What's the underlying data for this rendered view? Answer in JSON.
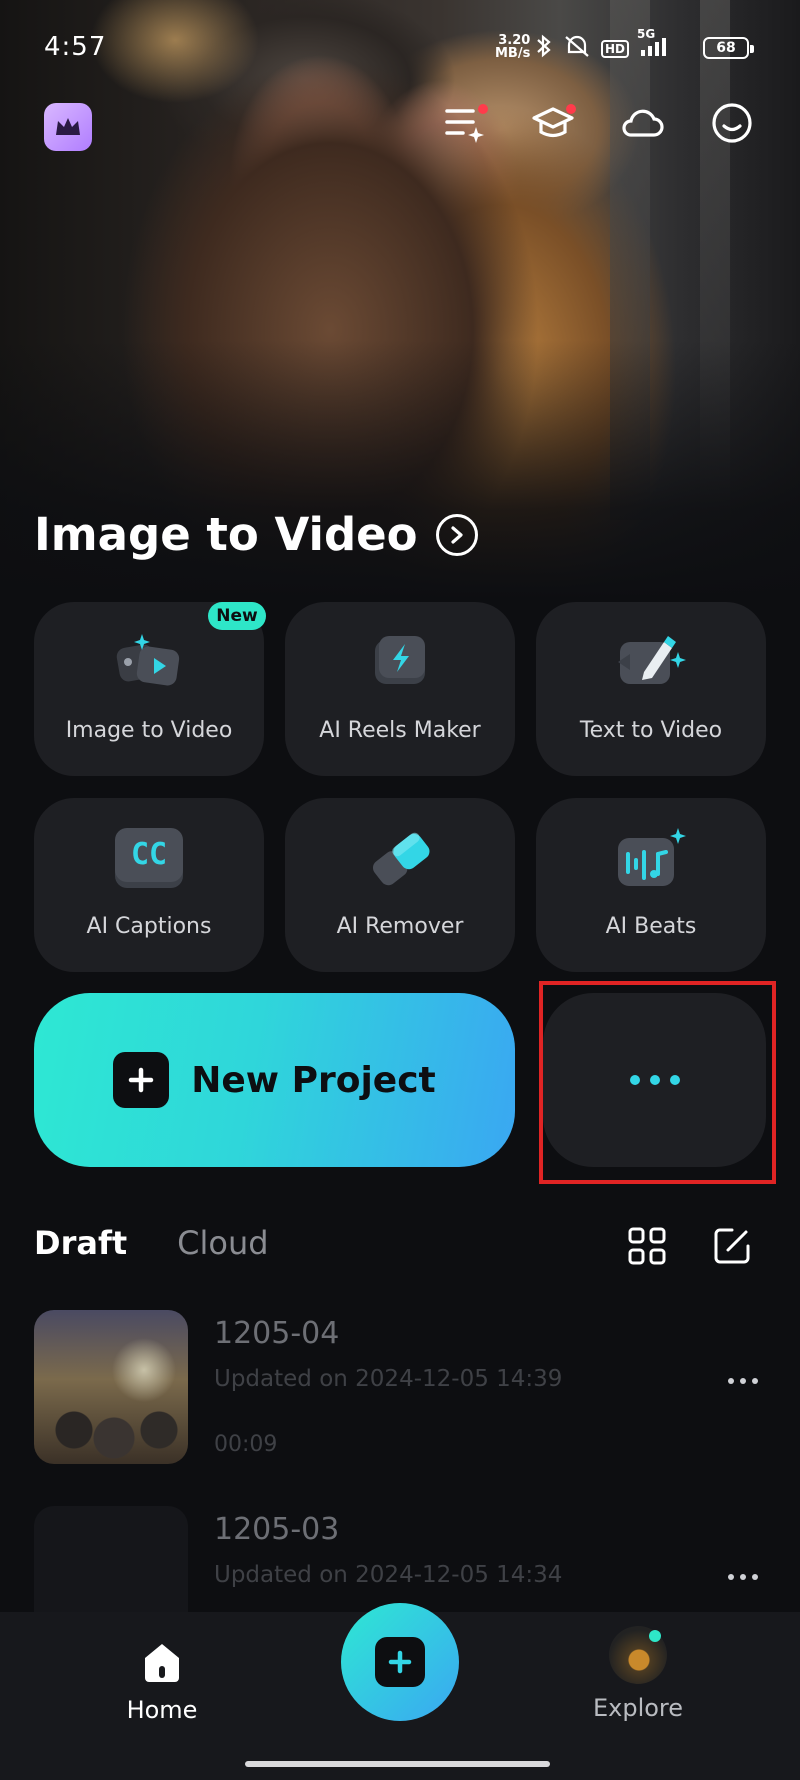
{
  "status_bar": {
    "time": "4:57",
    "net_speed_value": "3.20",
    "net_speed_unit": "MB/s",
    "network": "5G",
    "hd": "HD",
    "battery": "68"
  },
  "hero": {
    "title": "Image to Video"
  },
  "tools": [
    {
      "label": "Image to Video",
      "badge": "New"
    },
    {
      "label": "AI Reels Maker"
    },
    {
      "label": "Text to Video"
    },
    {
      "label": "AI Captions"
    },
    {
      "label": "AI Remover"
    },
    {
      "label": "AI Beats"
    }
  ],
  "tool_icon_text": {
    "captions": "CC"
  },
  "new_project": {
    "label": "New Project"
  },
  "tabs": {
    "draft": "Draft",
    "cloud": "Cloud"
  },
  "drafts": [
    {
      "title": "1205-04",
      "updated": "Updated on 2024-12-05 14:39",
      "duration": "00:09"
    },
    {
      "title": "1205-03",
      "updated": "Updated on 2024-12-05 14:34",
      "duration": ""
    }
  ],
  "bottom_nav": {
    "home": "Home",
    "explore": "Explore"
  },
  "colors": {
    "accent": "#2ee8d3",
    "accent2": "#3aa7f2",
    "highlight": "#e02424",
    "card": "#1e1f23"
  }
}
